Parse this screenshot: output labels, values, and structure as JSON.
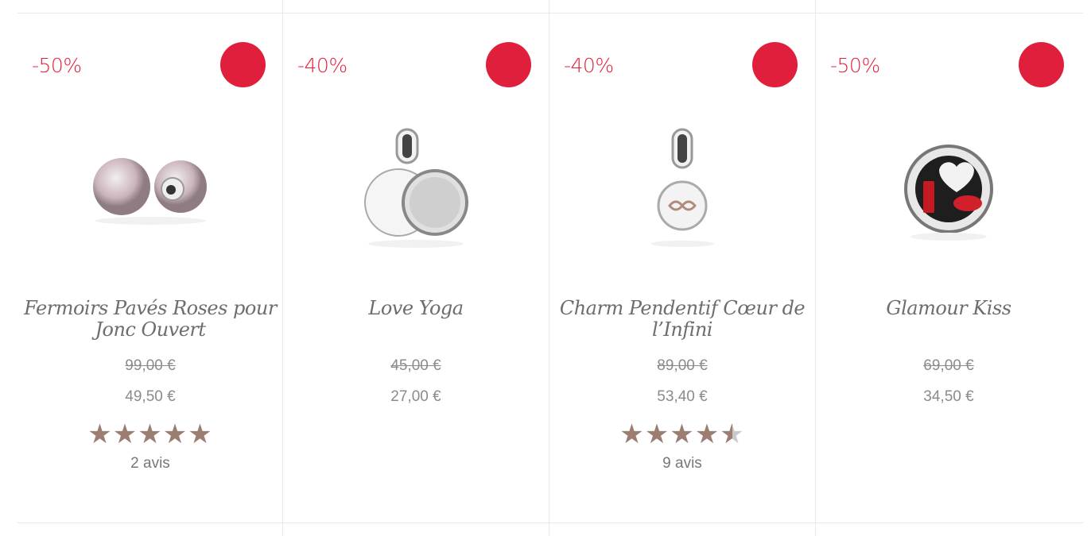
{
  "products": [
    {
      "discount": "-50%",
      "title": "Fermoirs Pavés Roses pour Jonc Ouvert",
      "old_price": "99,00 €",
      "new_price": "49,50 €",
      "rating": 5,
      "reviews": "2 avis",
      "image_icon": "clasp-charm-icon"
    },
    {
      "discount": "-40%",
      "title": "Love Yoga",
      "old_price": "45,00 €",
      "new_price": "27,00 €",
      "rating": null,
      "reviews": "",
      "image_icon": "dangle-disc-charm-icon"
    },
    {
      "discount": "-40%",
      "title": "Charm Pendentif Cœur de l’Infini",
      "old_price": "89,00 €",
      "new_price": "53,40 €",
      "rating": 4.5,
      "reviews": "9 avis",
      "image_icon": "infinity-pendant-icon"
    },
    {
      "discount": "-50%",
      "title": "Glamour Kiss",
      "old_price": "69,00 €",
      "new_price": "34,50 €",
      "rating": null,
      "reviews": "",
      "image_icon": "kiss-charm-icon"
    }
  ],
  "colors": {
    "badge": "#e01f3c",
    "discount_text": "#e4213b",
    "star": "#9c7d72"
  }
}
